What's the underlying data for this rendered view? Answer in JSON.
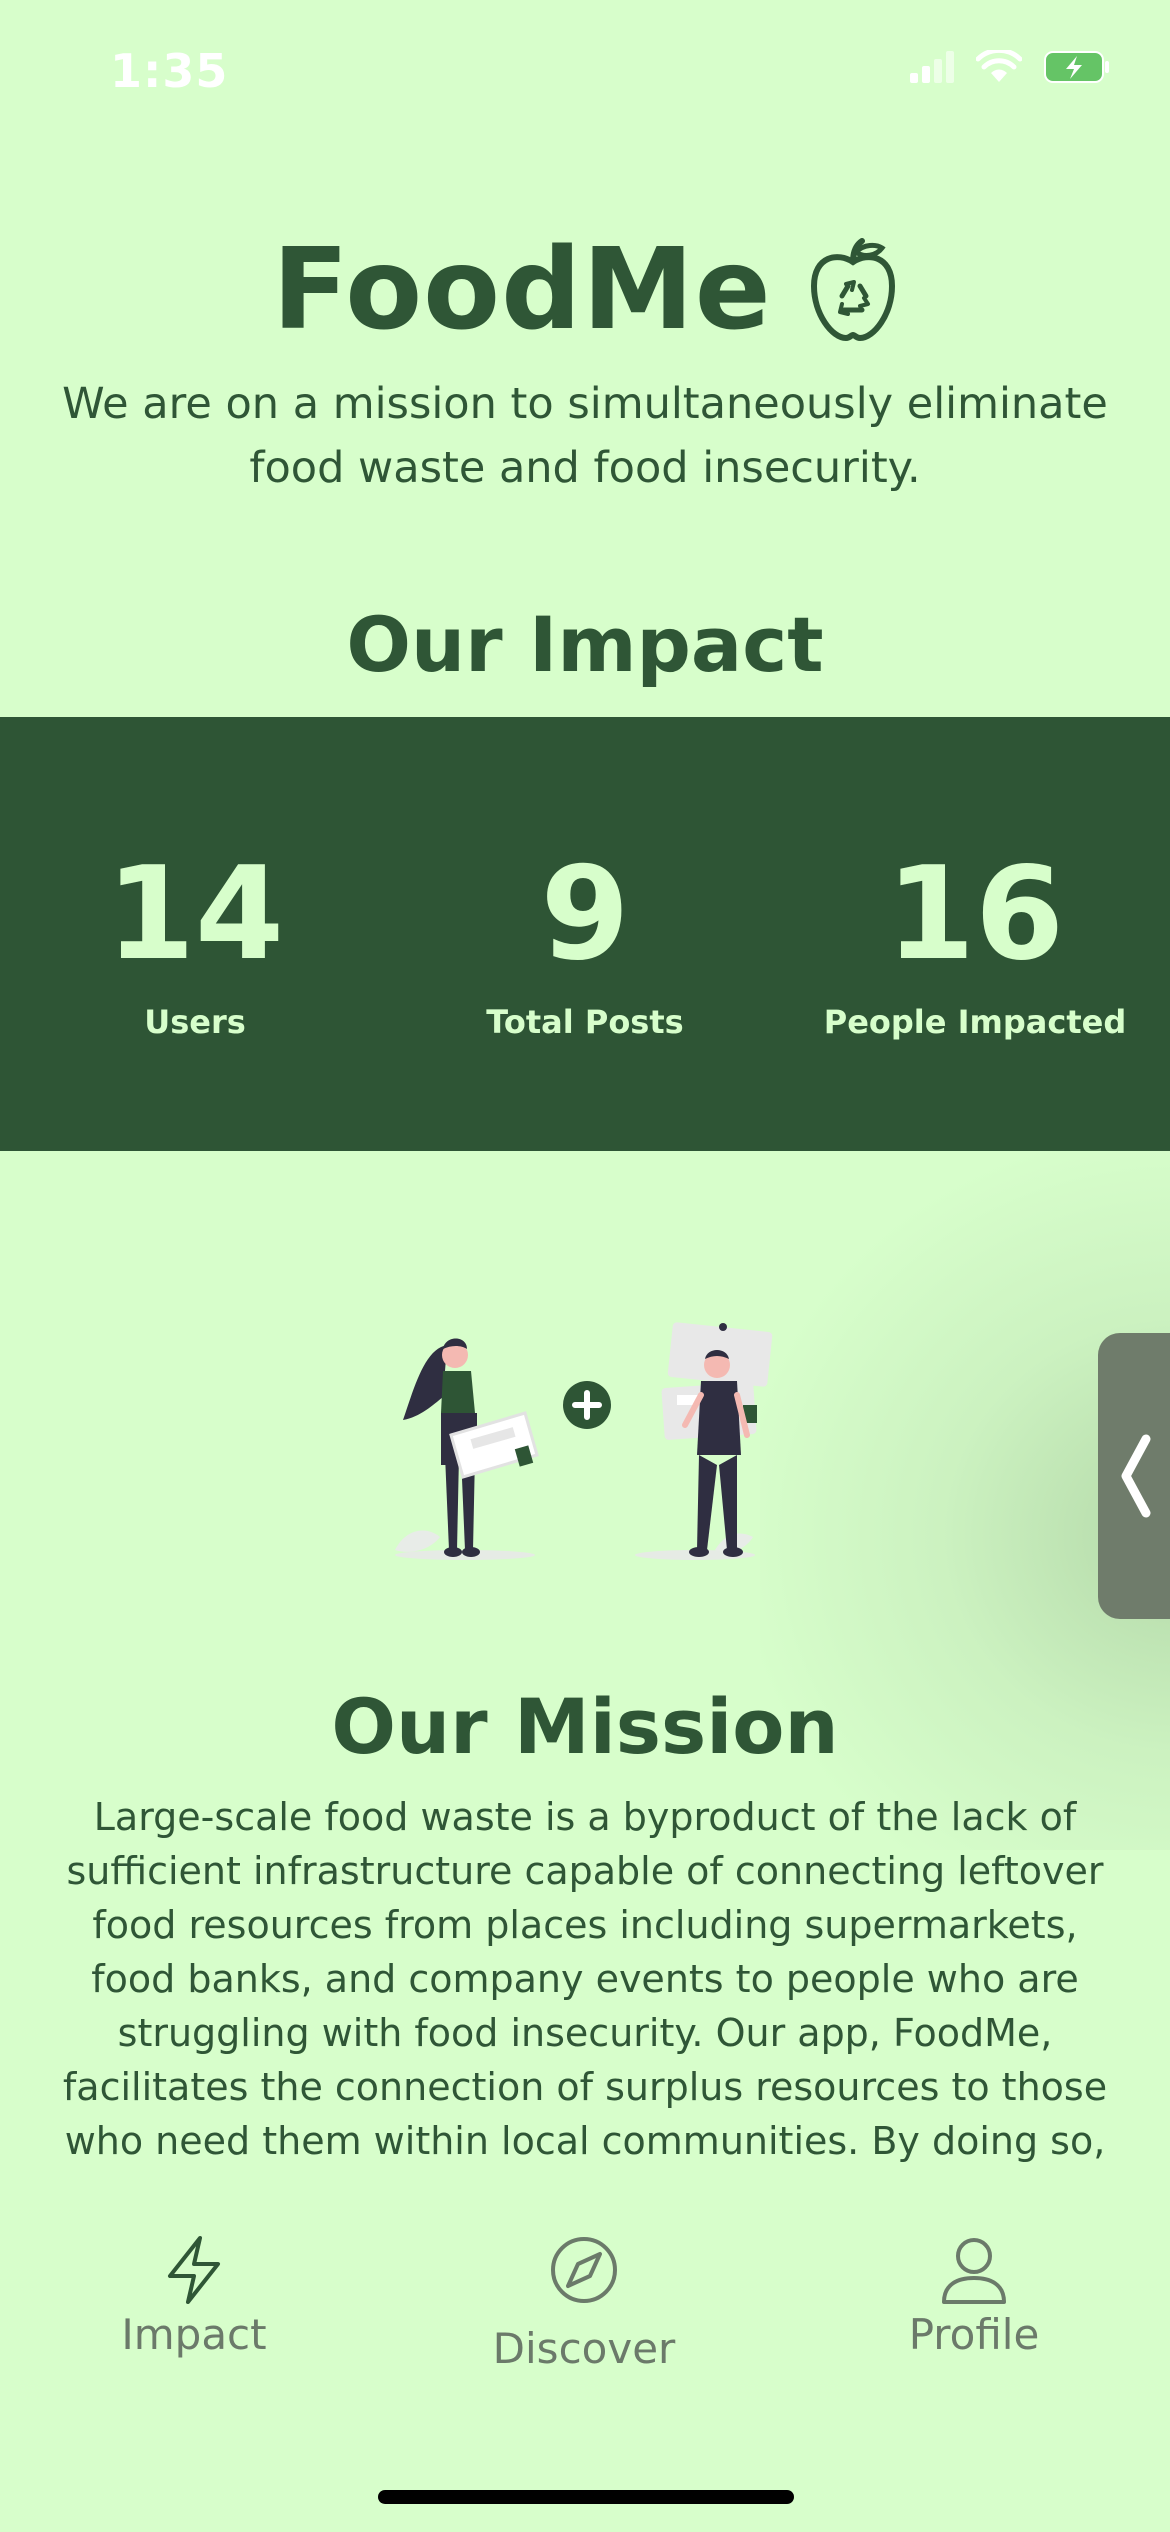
{
  "status_bar": {
    "time": "1:35"
  },
  "header": {
    "app_name": "FoodMe",
    "tagline": "We are on a mission to simultaneously eliminate food waste and food insecurity."
  },
  "impact": {
    "title": "Our Impact",
    "stats": [
      {
        "value": "14",
        "label": "Users"
      },
      {
        "value": "9",
        "label": "Total Posts"
      },
      {
        "value": "16",
        "label": "People Impacted"
      }
    ]
  },
  "mission": {
    "title": "Our Mission",
    "body": "Large-scale food waste is a byproduct of the lack of sufficient infrastructure capable of connecting leftover food resources from places including supermarkets, food banks, and company events to people who are struggling with food insecurity. Our app, FoodMe, facilitates the connection of surplus resources to those who need them within local communities. By doing so, we aim to alleviate"
  },
  "tab_bar": {
    "items": [
      {
        "label": "Impact",
        "icon": "lightning-icon"
      },
      {
        "label": "Discover",
        "icon": "compass-icon"
      },
      {
        "label": "Profile",
        "icon": "person-icon"
      }
    ]
  },
  "colors": {
    "background": "#d7fecb",
    "primary": "#2e5535",
    "accent_text": "#d7fecb",
    "inactive_tab": "#6b7a6a"
  }
}
